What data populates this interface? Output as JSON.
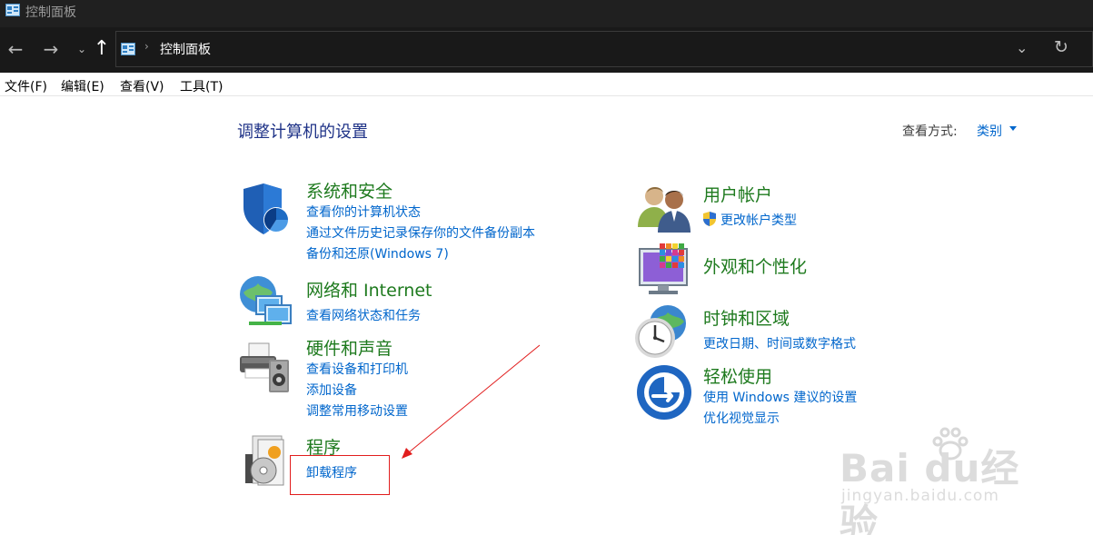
{
  "window": {
    "title": "控制面板"
  },
  "address": {
    "crumb": "控制面板"
  },
  "menu": [
    "文件(F)",
    "编辑(E)",
    "查看(V)",
    "工具(T)"
  ],
  "main": {
    "title": "调整计算机的设置",
    "view_by_label": "查看方式:",
    "view_by_value": "类别"
  },
  "categories": {
    "system_security": {
      "title": "系统和安全",
      "links": [
        "查看你的计算机状态",
        "通过文件历史记录保存你的文件备份副本",
        "备份和还原(Windows 7)"
      ],
      "icon": "shield-icon"
    },
    "network": {
      "title": "网络和 Internet",
      "links": [
        "查看网络状态和任务"
      ],
      "icon": "network-icon"
    },
    "hardware": {
      "title": "硬件和声音",
      "links": [
        "查看设备和打印机",
        "添加设备",
        "调整常用移动设置"
      ],
      "icon": "printer-icon"
    },
    "programs": {
      "title": "程序",
      "links": [
        "卸载程序"
      ],
      "icon": "programs-icon"
    },
    "user_accounts": {
      "title": "用户帐户",
      "links": [
        "更改帐户类型"
      ],
      "icon": "users-icon"
    },
    "appearance": {
      "title": "外观和个性化",
      "links": [],
      "icon": "monitor-icon"
    },
    "clock": {
      "title": "时钟和区域",
      "links": [
        "更改日期、时间或数字格式"
      ],
      "icon": "clock-icon"
    },
    "ease": {
      "title": "轻松使用",
      "links": [
        "使用 Windows 建议的设置",
        "优化视觉显示"
      ],
      "icon": "ease-of-access-icon"
    }
  },
  "watermark": {
    "brand": "Bai du经验",
    "url": "jingyan.baidu.com"
  },
  "colors": {
    "title_blue": "#1e3287",
    "category_green": "#1e7a1e",
    "link_blue": "#0066cc",
    "annotation_red": "#e11d1d"
  }
}
